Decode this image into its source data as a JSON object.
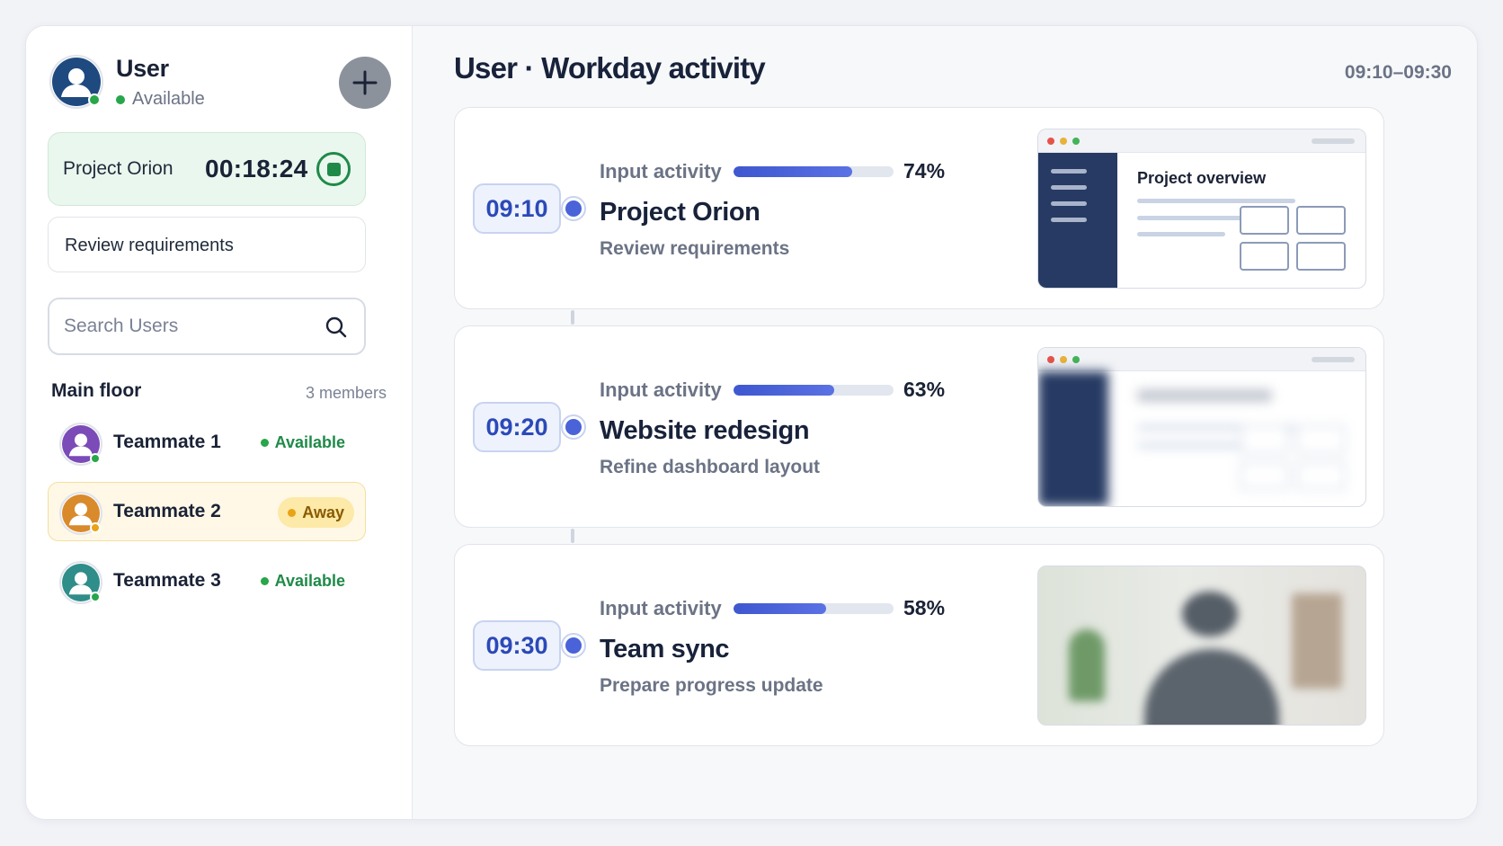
{
  "user": {
    "name": "User",
    "status": "Available"
  },
  "timer": {
    "project": "Project Orion",
    "elapsed": "00:18:24"
  },
  "current_task": "Review requirements",
  "search": {
    "placeholder": "Search Users",
    "value": ""
  },
  "group": {
    "title": "Main floor",
    "count": "3 members",
    "members": [
      {
        "name": "Teammate 1",
        "status": "Available",
        "avatar_color": "#7b4bb8"
      },
      {
        "name": "Teammate 2",
        "status": "Away",
        "avatar_color": "#d98a2b"
      },
      {
        "name": "Teammate 3",
        "status": "Available",
        "avatar_color": "#2f8d8a"
      }
    ]
  },
  "header": {
    "title": "User · Workday activity",
    "range": "09:10–09:30"
  },
  "entries": [
    {
      "time": "09:10",
      "activity_label": "Input activity",
      "activity_pct": 74,
      "activity_text": "74%",
      "project": "Project Orion",
      "task": "Review requirements",
      "screenshot_heading": "Project overview"
    },
    {
      "time": "09:20",
      "activity_label": "Input activity",
      "activity_pct": 63,
      "activity_text": "63%",
      "project": "Website redesign",
      "task": "Refine dashboard layout"
    },
    {
      "time": "09:30",
      "activity_label": "Input activity",
      "activity_pct": 58,
      "activity_text": "58%",
      "project": "Team sync",
      "task": "Prepare progress update"
    }
  ],
  "colors": {
    "accent": "#4a63d8",
    "available": "#27a64a",
    "away": "#e8a317",
    "user_avatar": "#1e4a80"
  },
  "icons": {
    "add": "plus-icon",
    "stop": "stop-icon",
    "search": "search-icon",
    "avatar": "user-icon"
  }
}
